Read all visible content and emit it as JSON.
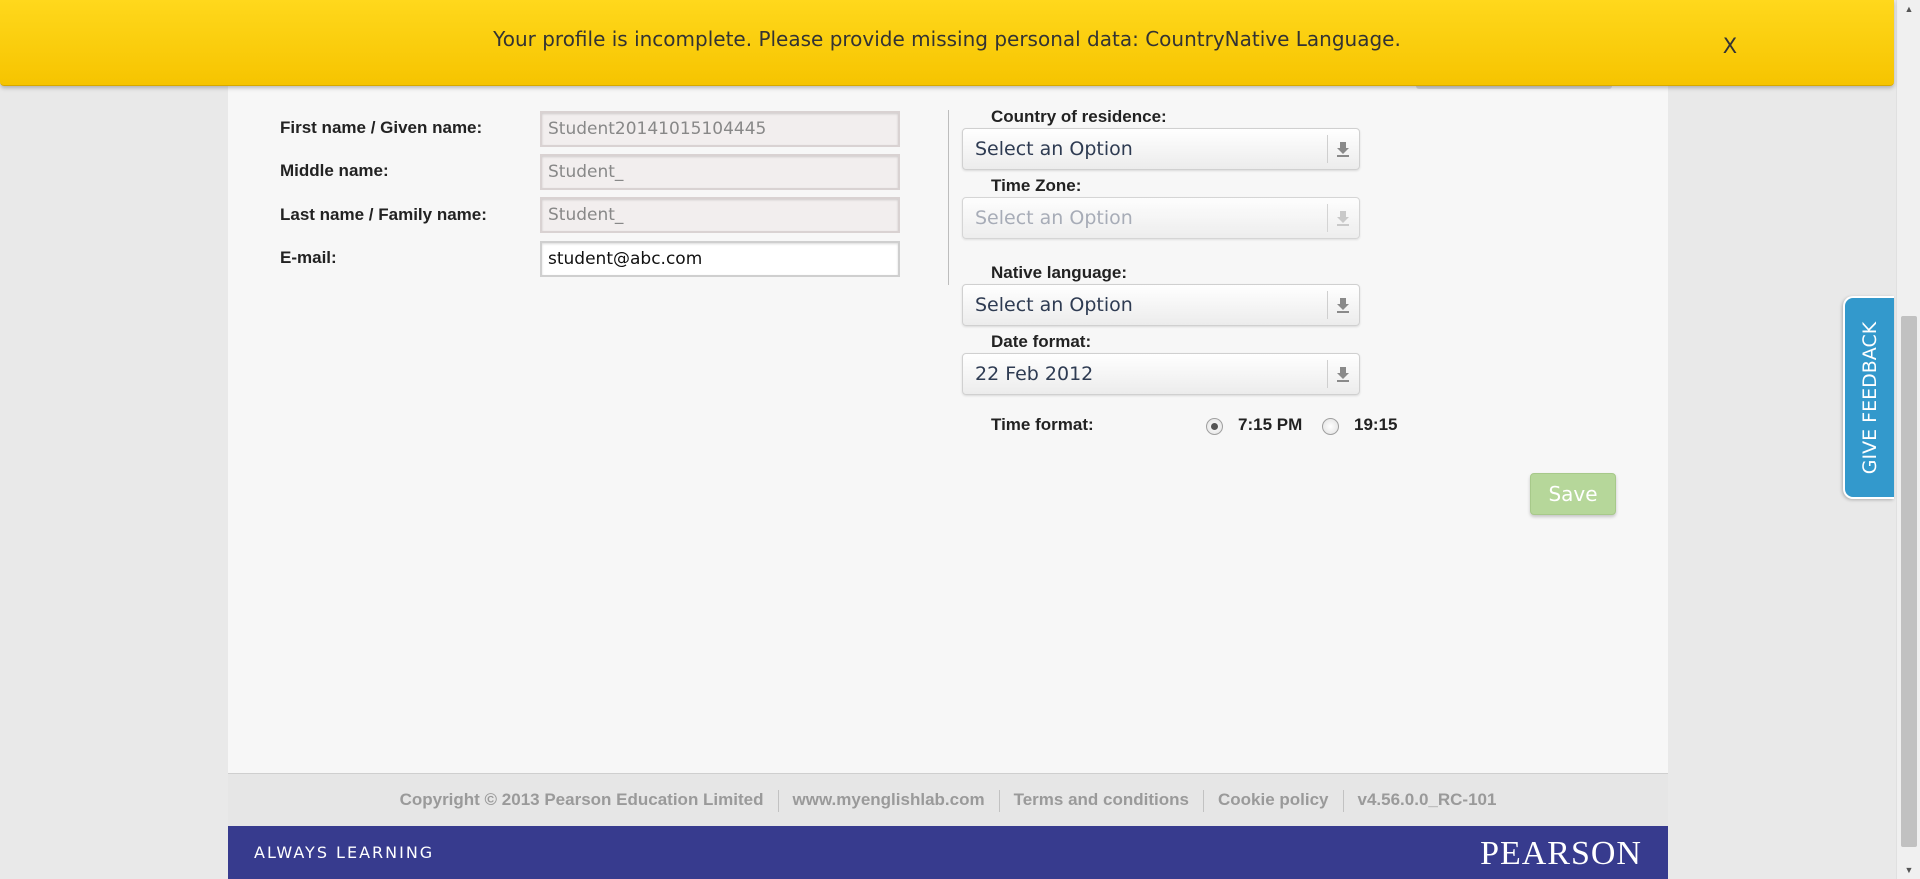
{
  "banner": {
    "message": "Your profile is incomplete. Please provide missing personal data: CountryNative Language.",
    "close_label": "X"
  },
  "profile": {
    "first_name_label": "First name / Given name:",
    "first_name_value": "Student20141015104445",
    "middle_name_label": "Middle name:",
    "middle_name_value": "Student_",
    "last_name_label": "Last name / Family name:",
    "last_name_value": "Student_",
    "email_label": "E-mail:",
    "email_value": "student@abc.com"
  },
  "settings": {
    "country_label": "Country of residence:",
    "country_value": "Select an Option",
    "timezone_label": "Time Zone:",
    "timezone_value": "Select an Option",
    "native_language_label": "Native language:",
    "native_language_value": "Select an Option",
    "date_format_label": "Date format:",
    "date_format_value": "22 Feb 2012",
    "time_format_label": "Time format:",
    "time_format_options": [
      "7:15 PM",
      "19:15"
    ],
    "time_format_selected": "7:15 PM"
  },
  "actions": {
    "save_label": "Save"
  },
  "feedback": {
    "label": "GIVE FEEDBACK"
  },
  "footer": {
    "links": [
      "Copyright © 2013 Pearson Education Limited",
      "www.myenglishlab.com",
      "Terms and conditions",
      "Cookie policy",
      "v4.56.0.0_RC-101"
    ],
    "tagline": "ALWAYS LEARNING",
    "brand": "PEARSON"
  },
  "colors": {
    "banner_bg": "#ffd81c",
    "save_button_bg": "#b6d79a",
    "brand_bar_bg": "#373b8e",
    "feedback_bg": "#3399cc"
  }
}
